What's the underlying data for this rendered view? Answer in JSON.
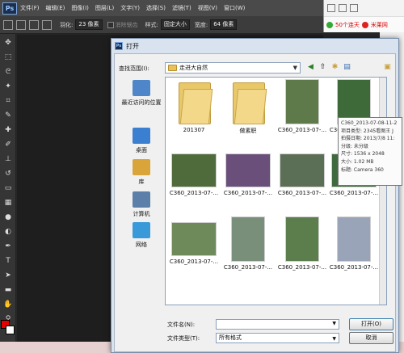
{
  "photoshop": {
    "logo": "Ps",
    "menu": [
      "文件(F)",
      "编辑(E)",
      "图像(I)",
      "图层(L)",
      "文字(Y)",
      "选择(S)",
      "滤镜(T)",
      "视图(V)",
      "窗口(W)"
    ],
    "options": {
      "feather_label": "羽化:",
      "feather_value": "23 像素",
      "antialias_label": "消除锯齿",
      "style_label": "样式:",
      "style_value": "固定大小",
      "width_label": "宽度:",
      "width_value": "64 像素"
    },
    "tools": [
      "move",
      "marquee",
      "lasso",
      "magic-wand",
      "crop",
      "eyedropper",
      "healing",
      "brush",
      "stamp",
      "history-brush",
      "eraser",
      "gradient",
      "blur",
      "dodge",
      "pen",
      "type",
      "path-select",
      "shape",
      "hand",
      "zoom"
    ],
    "foreground_color": "#e30000",
    "background_color": "#ffffff"
  },
  "browser": {
    "bookmark1": "50个连天",
    "bookmark2": "米莱网"
  },
  "dialog": {
    "title": "打开",
    "look_in_label": "查找范围(I):",
    "look_in_value": "走进大自然",
    "places": [
      {
        "label": "最近访问的位置",
        "icon": "recent-places-icon",
        "color": "#4f86c9"
      },
      {
        "label": "桌面",
        "icon": "desktop-icon",
        "color": "#3a7fd0"
      },
      {
        "label": "库",
        "icon": "library-icon",
        "color": "#d9a53a"
      },
      {
        "label": "计算机",
        "icon": "computer-icon",
        "color": "#5b7fa8"
      },
      {
        "label": "网络",
        "icon": "network-icon",
        "color": "#3a9ad9"
      }
    ],
    "files": [
      {
        "name": "201307",
        "kind": "folder"
      },
      {
        "name": "做素职",
        "kind": "folder"
      },
      {
        "name": "C360_2013-07-...",
        "kind": "image",
        "color": "#5f7a4a"
      },
      {
        "name": "C360_2013-07-...",
        "kind": "image",
        "color": "#3e6a3a"
      },
      {
        "name": "C360_2013-07-...",
        "kind": "image",
        "color": "#4f6b3c"
      },
      {
        "name": "C360_2013-07-...",
        "kind": "image",
        "color": "#6a4f7a"
      },
      {
        "name": "C360_2013-07-...",
        "kind": "image",
        "color": "#5a6f55"
      },
      {
        "name": "C360_2013-07-...",
        "kind": "image",
        "color": "#3f6a3f"
      },
      {
        "name": "C360_2013-07-...",
        "kind": "image",
        "color": "#6f8a5a"
      },
      {
        "name": "C360_2013-07-...",
        "kind": "image",
        "color": "#7a8f7a"
      },
      {
        "name": "C360_2013-07-...",
        "kind": "image",
        "color": "#5c7d4c"
      },
      {
        "name": "C360_2013-07-...",
        "kind": "image",
        "color": "#9aa4b8"
      }
    ],
    "tooltip": [
      "C360_2013-07-08-11-2",
      "项目类型: 2345看图王 J",
      "拍摄日期: 2013/7/8 11:",
      "分级: 未分级",
      "尺寸: 1536 x 2048",
      "大小: 1.02 MB",
      "标题: Camera 360"
    ],
    "file_name_label": "文件名(N):",
    "file_name_value": "",
    "file_type_label": "文件类型(T):",
    "file_type_value": "所有格式",
    "open_button": "打开(O)",
    "cancel_button": "取消"
  }
}
